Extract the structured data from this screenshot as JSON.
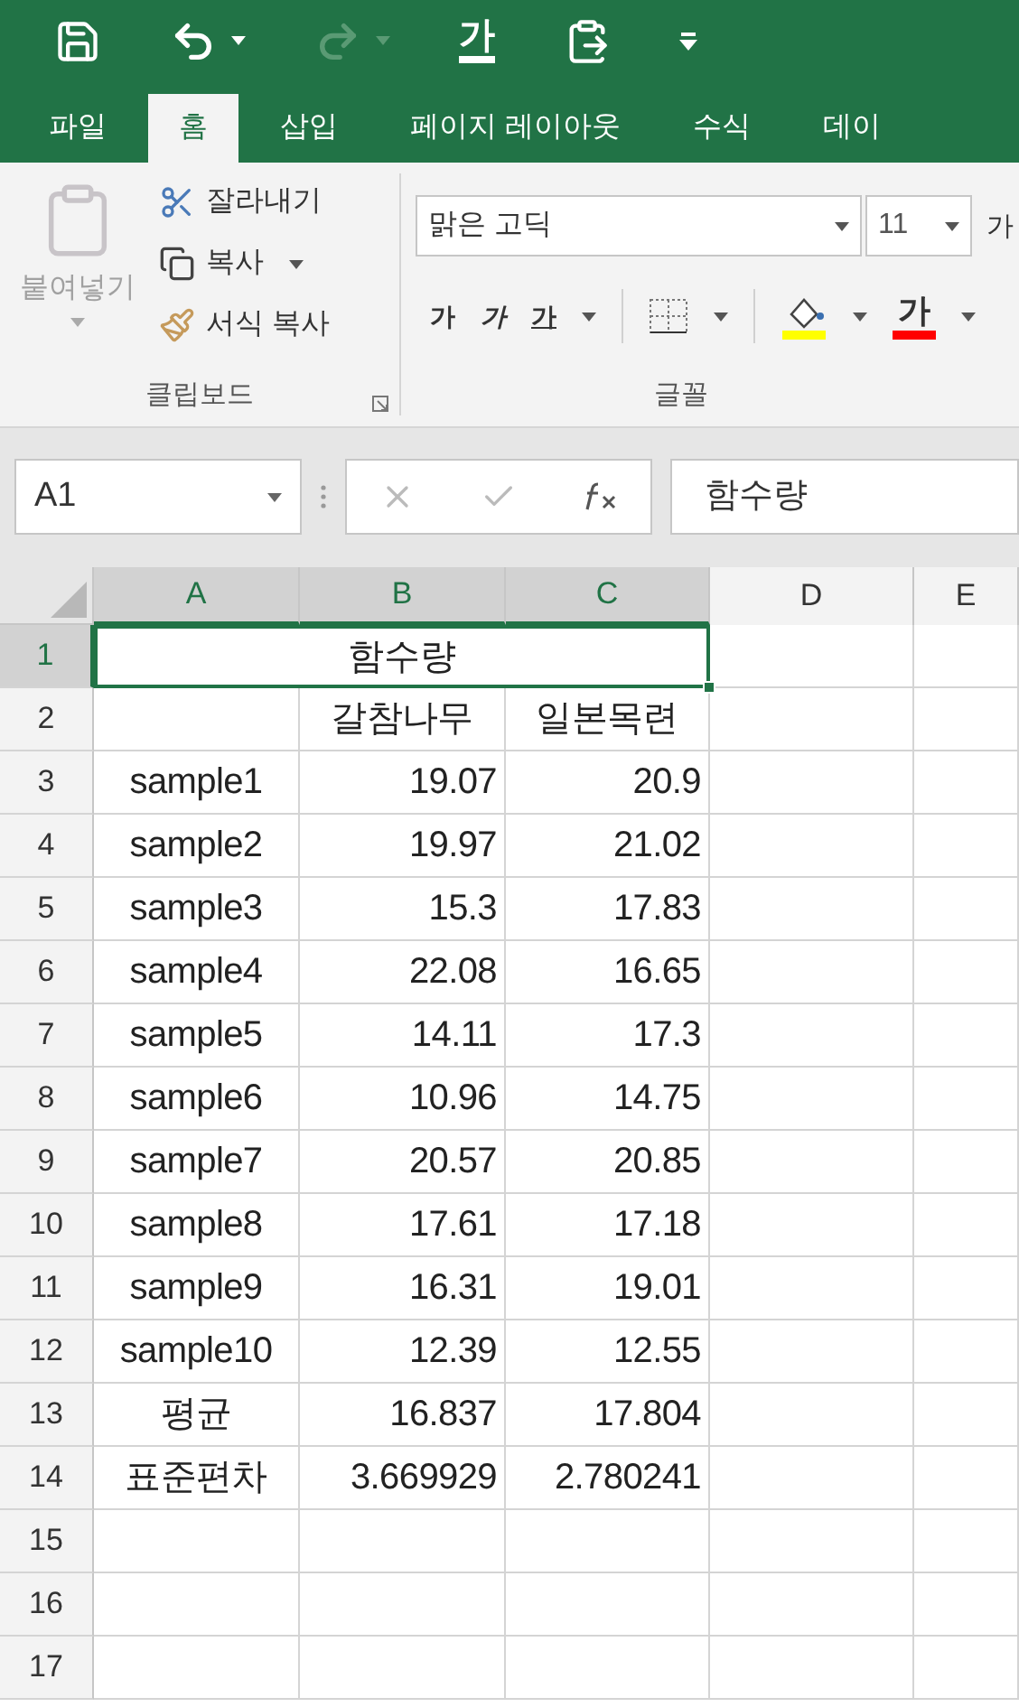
{
  "quick_access": [
    {
      "kind": "save",
      "disabled": false
    },
    {
      "kind": "undo",
      "disabled": false
    },
    {
      "kind": "redo",
      "disabled": true
    },
    {
      "kind": "glyph",
      "text": "가",
      "disabled": false
    },
    {
      "kind": "paste",
      "disabled": false
    },
    {
      "kind": "customize",
      "disabled": false
    }
  ],
  "tabs": [
    {
      "label": "파일",
      "selected": false
    },
    {
      "label": "홈",
      "selected": true
    },
    {
      "label": "삽입",
      "selected": false
    },
    {
      "label": "페이지 레이아웃",
      "selected": false
    },
    {
      "label": "수식",
      "selected": false
    },
    {
      "label": "데이",
      "selected": false
    }
  ],
  "clipboard": {
    "label": "클립보드",
    "paste": {
      "label": "붙여넣기",
      "disabled": true
    },
    "actions": [
      {
        "kind": "cut",
        "label": "잘라내기",
        "dropdown": false
      },
      {
        "kind": "copy",
        "label": "복사",
        "dropdown": true
      },
      {
        "kind": "format_painter",
        "label": "서식 복사",
        "dropdown": false
      }
    ]
  },
  "font": {
    "label": "글꼴",
    "font_name": "맑은 고딕",
    "font_size": "11",
    "grow_font": "가",
    "bold": "가",
    "italic": "가",
    "underline": "가",
    "font_color": "가"
  },
  "formula_bar": {
    "name_box": "A1",
    "content": "함수량"
  },
  "columns": [
    {
      "label": "A",
      "selected": true
    },
    {
      "label": "B",
      "selected": true
    },
    {
      "label": "C",
      "selected": true
    },
    {
      "label": "D",
      "selected": false
    },
    {
      "label": "E",
      "selected": false
    }
  ],
  "rows": [
    {
      "number": "1",
      "selected": true,
      "kind": "title",
      "cells": [
        "함수량"
      ]
    },
    {
      "number": "2",
      "selected": false,
      "kind": "header",
      "cells": [
        "",
        "갈참나무",
        "일본목련"
      ]
    },
    {
      "number": "3",
      "selected": false,
      "kind": "data",
      "cells": [
        "sample1",
        "19.07",
        "20.9"
      ]
    },
    {
      "number": "4",
      "selected": false,
      "kind": "data",
      "cells": [
        "sample2",
        "19.97",
        "21.02"
      ]
    },
    {
      "number": "5",
      "selected": false,
      "kind": "data",
      "cells": [
        "sample3",
        "15.3",
        "17.83"
      ]
    },
    {
      "number": "6",
      "selected": false,
      "kind": "data",
      "cells": [
        "sample4",
        "22.08",
        "16.65"
      ]
    },
    {
      "number": "7",
      "selected": false,
      "kind": "data",
      "cells": [
        "sample5",
        "14.11",
        "17.3"
      ]
    },
    {
      "number": "8",
      "selected": false,
      "kind": "data",
      "cells": [
        "sample6",
        "10.96",
        "14.75"
      ]
    },
    {
      "number": "9",
      "selected": false,
      "kind": "data",
      "cells": [
        "sample7",
        "20.57",
        "20.85"
      ]
    },
    {
      "number": "10",
      "selected": false,
      "kind": "data",
      "cells": [
        "sample8",
        "17.61",
        "17.18"
      ]
    },
    {
      "number": "11",
      "selected": false,
      "kind": "data",
      "cells": [
        "sample9",
        "16.31",
        "19.01"
      ]
    },
    {
      "number": "12",
      "selected": false,
      "kind": "data",
      "cells": [
        "sample10",
        "12.39",
        "12.55"
      ]
    },
    {
      "number": "13",
      "selected": false,
      "kind": "data",
      "cells": [
        "평균",
        "16.837",
        "17.804"
      ]
    },
    {
      "number": "14",
      "selected": false,
      "kind": "data",
      "cells": [
        "표준편차",
        "3.669929",
        "2.780241"
      ]
    },
    {
      "number": "15",
      "selected": false,
      "kind": "empty",
      "cells": []
    },
    {
      "number": "16",
      "selected": false,
      "kind": "empty",
      "cells": []
    },
    {
      "number": "17",
      "selected": false,
      "kind": "empty",
      "cells": []
    }
  ]
}
